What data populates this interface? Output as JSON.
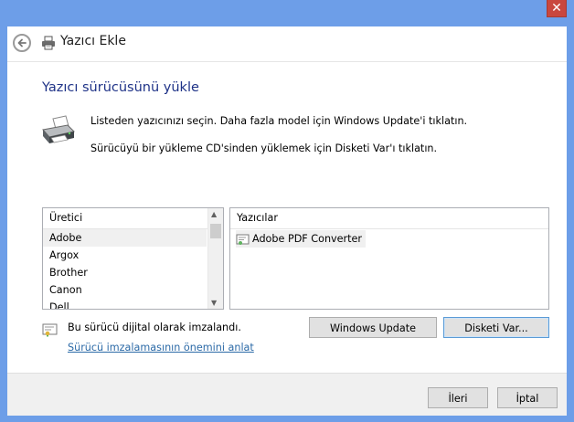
{
  "window": {
    "title": "Yazıcı Ekle",
    "close_glyph": "✕"
  },
  "page": {
    "heading": "Yazıcı sürücüsünü yükle",
    "line1": "Listeden yazıcınızı seçin. Daha fazla model için Windows Update'i tıklatın.",
    "line2": "Sürücüyü bir yükleme CD'sinden yüklemek için Disketi Var'ı tıklatın."
  },
  "manufacturers": {
    "header": "Üretici",
    "items": [
      "Adobe",
      "Argox",
      "Brother",
      "Canon",
      "Dell"
    ],
    "selected": "Adobe"
  },
  "printers": {
    "header": "Yazıcılar",
    "items": [
      "Adobe PDF Converter"
    ]
  },
  "signature": {
    "status": "Bu sürücü dijital olarak imzalandı.",
    "link": "Sürücü imzalamasının önemini anlat"
  },
  "buttons": {
    "windows_update": "Windows Update",
    "have_disk": "Disketi Var...",
    "next": "İleri",
    "cancel": "İptal"
  },
  "colors": {
    "title_bar": "#6d9ee8",
    "heading": "#1e3287",
    "link": "#2c6aa7",
    "close": "#c9473e"
  }
}
